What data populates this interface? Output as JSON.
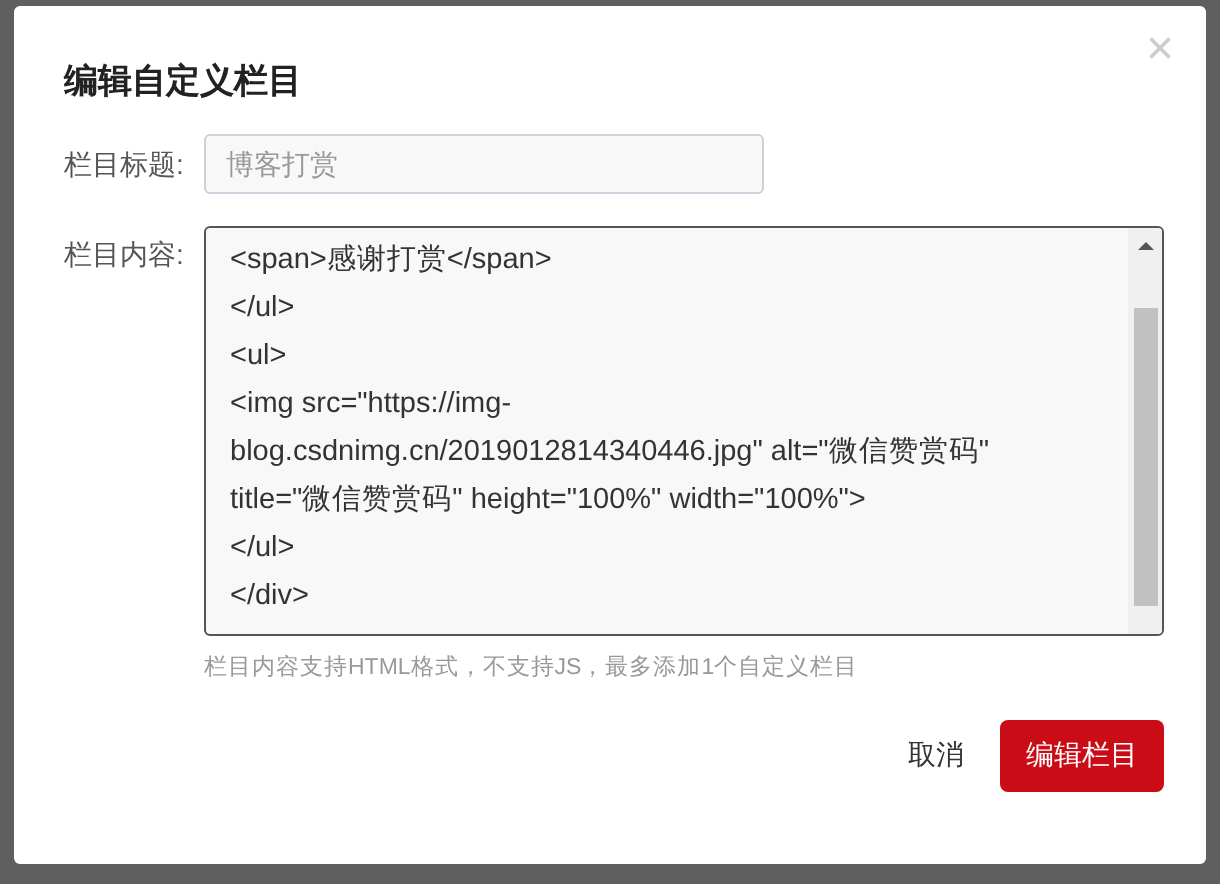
{
  "dialog": {
    "title": "编辑自定义栏目",
    "close": "×"
  },
  "title_field": {
    "label": "栏目标题:",
    "placeholder": "博客打赏"
  },
  "content_field": {
    "label": "栏目内容:",
    "lines": [
      "<span>感谢打赏</span>",
      "</ul>",
      "<ul>",
      "<img src=\"https://img-",
      "blog.csdnimg.cn/2019012814340446.jpg\" alt=\"微信赞赏码\"",
      "title=\"微信赞赏码\" height=\"100%\" width=\"100%\">",
      "</ul>",
      "</div>"
    ]
  },
  "hint": "栏目内容支持HTML格式，不支持JS，最多添加1个自定义栏目",
  "buttons": [
    {
      "label": "取消",
      "kind": "link"
    },
    {
      "label": "编辑栏目",
      "kind": "primary"
    }
  ]
}
